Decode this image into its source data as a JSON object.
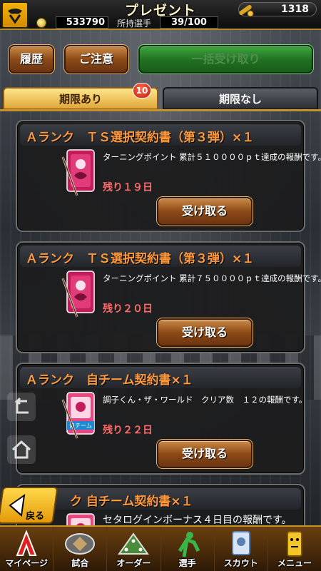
{
  "header": {
    "title": "プレゼント",
    "gold": "1318",
    "coins": "533790",
    "roster_label": "所持選手",
    "roster_value": "39/100"
  },
  "actions": {
    "history": "履歴",
    "notice": "ご注意",
    "receive_all": "一括受け取り"
  },
  "tabs": {
    "active_label": "期限あり",
    "active_badge": "10",
    "inactive_label": "期限なし"
  },
  "cards": [
    {
      "title": "Ａランク　ＴＳ選択契約書（第３弾）×１",
      "desc": "ターニングポイント 累計５１００００ｐｔ達成の報酬です。",
      "remain": "残り１９日",
      "button": "受け取る",
      "thumb": "contract-ts"
    },
    {
      "title": "Ａランク　ＴＳ選択契約書（第３弾）×１",
      "desc": "ターニングポイント 累計７５００００ｐｔ達成の報酬です。",
      "remain": "残り２０日",
      "button": "受け取る",
      "thumb": "contract-ts"
    },
    {
      "title": "Ａランク　自チーム契約書×１",
      "desc": "調子くん・ザ・ワールド　クリア数　１２の報酬です。",
      "remain": "残り２２日",
      "button": "受け取る",
      "thumb": "contract-team",
      "thumb_label": "自チーム"
    },
    {
      "title": "ク 自チーム契約書×１",
      "desc": "セタログインボーナス４日目の報酬です。",
      "remain": "",
      "button": "",
      "thumb": "contract-team"
    }
  ],
  "back_label": "戻る",
  "nav": [
    {
      "label": "マイページ",
      "icon": "mypage-icon"
    },
    {
      "label": "試合",
      "icon": "match-icon"
    },
    {
      "label": "オーダー",
      "icon": "order-icon"
    },
    {
      "label": "選手",
      "icon": "player-icon"
    },
    {
      "label": "スカウト",
      "icon": "scout-icon"
    },
    {
      "label": "メニュー",
      "icon": "menu-icon"
    }
  ],
  "colors": {
    "title_orange": "#ff9a3c",
    "remain_red": "#ff6b6b",
    "tab_active": "#e0a73a",
    "receive_all_green": "#206f22"
  }
}
